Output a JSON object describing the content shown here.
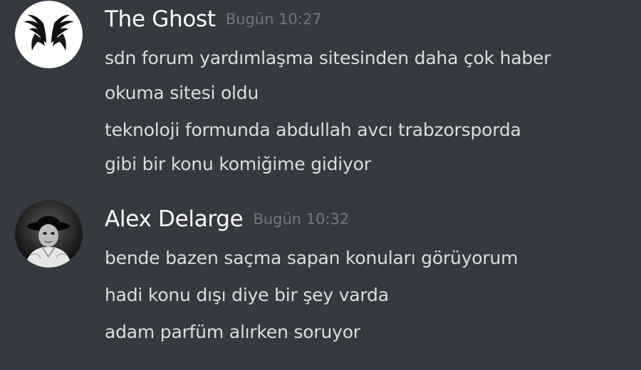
{
  "messages": [
    {
      "author": "The Ghost",
      "timestamp": "Bugün 10:27",
      "avatar_icon": "black-wings-icon",
      "lines": [
        "sdn forum yardımlaşma sitesinden daha çok haber",
        "okuma sitesi oldu",
        "teknoloji formunda abdullah avcı trabzorsporda",
        "gibi bir konu komiğime gidiyor"
      ]
    },
    {
      "author": "Alex Delarge",
      "timestamp": "Bugün 10:32",
      "avatar_icon": "bowler-hat-man-photo-icon",
      "lines": [
        "bende bazen saçma sapan konuları görüyorum",
        "hadi konu dışı diye bir şey varda",
        "adam parfüm alırken soruyor"
      ]
    }
  ],
  "colors": {
    "background": "#36393f",
    "username": "#ffffff",
    "timestamp": "#72767d",
    "message_text": "#dcddde"
  }
}
